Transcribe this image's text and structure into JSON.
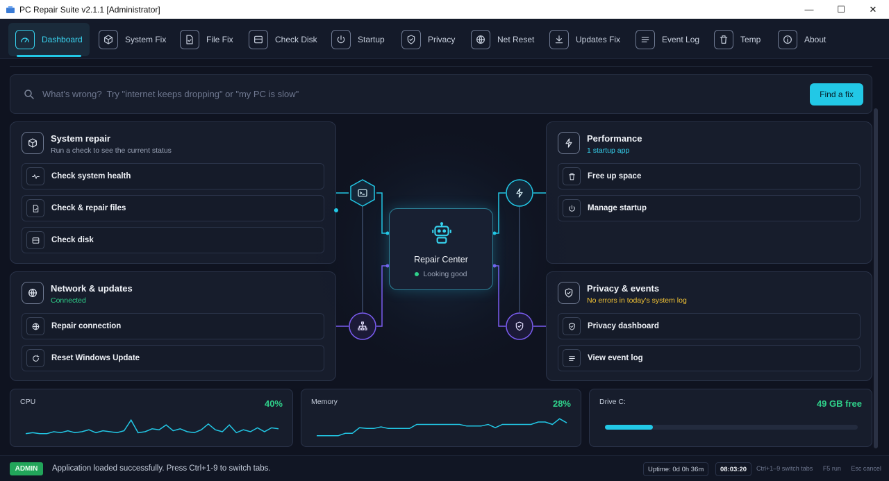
{
  "window": {
    "title": "PC Repair Suite v2.1.1 [Administrator]",
    "minimize": "—",
    "maximize": "☐",
    "close": "✕"
  },
  "nav": {
    "tabs": [
      {
        "label": "Dashboard",
        "icon": "gauge-icon",
        "active": true
      },
      {
        "label": "System Fix",
        "icon": "cube-icon"
      },
      {
        "label": "File Fix",
        "icon": "file-check-icon"
      },
      {
        "label": "Check Disk",
        "icon": "disk-icon"
      },
      {
        "label": "Startup",
        "icon": "power-icon"
      },
      {
        "label": "Privacy",
        "icon": "shield-icon"
      },
      {
        "label": "Net Reset",
        "icon": "globe-icon"
      },
      {
        "label": "Updates Fix",
        "icon": "download-icon"
      },
      {
        "label": "Event Log",
        "icon": "list-icon"
      },
      {
        "label": "Temp",
        "icon": "trash-icon"
      },
      {
        "label": "About",
        "icon": "info-icon"
      }
    ]
  },
  "search": {
    "placeholder": "What's wrong?  Try \"internet keeps dropping\" or \"my PC is slow\"",
    "button": "Find a fix"
  },
  "cards": {
    "system_repair": {
      "title": "System repair",
      "subtitle": "Run a check to see the current status",
      "actions": [
        "Check system health",
        "Check & repair files",
        "Check disk"
      ]
    },
    "network": {
      "title": "Network & updates",
      "subtitle": "Connected",
      "actions": [
        "Repair connection",
        "Reset Windows Update"
      ]
    },
    "performance": {
      "title": "Performance",
      "subtitle": "1 startup app",
      "actions": [
        "Free up space",
        "Manage startup"
      ]
    },
    "privacy": {
      "title": "Privacy & events",
      "subtitle": "No errors in today's system log",
      "actions": [
        "Privacy dashboard",
        "View event log"
      ]
    }
  },
  "repair_center": {
    "title": "Repair Center",
    "status": "Looking good"
  },
  "metrics": {
    "cpu": {
      "label": "CPU",
      "value": "40%",
      "series": [
        3,
        4,
        3,
        3,
        5,
        4,
        6,
        4,
        5,
        7,
        4,
        6,
        5,
        4,
        6,
        17,
        4,
        5,
        8,
        7,
        12,
        6,
        8,
        5,
        4,
        7,
        13,
        7,
        5,
        12,
        4,
        7,
        5,
        9,
        5,
        9,
        8
      ]
    },
    "memory": {
      "label": "Memory",
      "value": "28%",
      "series": [
        1,
        1,
        1,
        1,
        4,
        4,
        11,
        10,
        10,
        12,
        10,
        10,
        10,
        10,
        15,
        15,
        15,
        15,
        15,
        15,
        15,
        13,
        13,
        13,
        15,
        11,
        15,
        15,
        15,
        15,
        15,
        18,
        18,
        15,
        22,
        17
      ]
    },
    "drive": {
      "label": "Drive C:",
      "value": "49 GB free",
      "used_fraction": 0.19
    }
  },
  "status": {
    "badge": "ADMIN",
    "message": "Application loaded successfully. Press Ctrl+1-9 to switch tabs.",
    "uptime": "Uptime: 0d 0h 36m",
    "clock": "08:03:20",
    "hint_tabs": "Ctrl+1–9  switch tabs",
    "hint_run": "F5  run",
    "hint_cancel": "Esc  cancel"
  },
  "colors": {
    "accent": "#22c8e6",
    "success": "#2fd08a",
    "warning": "#f2c335",
    "purple": "#7a5cf0"
  }
}
